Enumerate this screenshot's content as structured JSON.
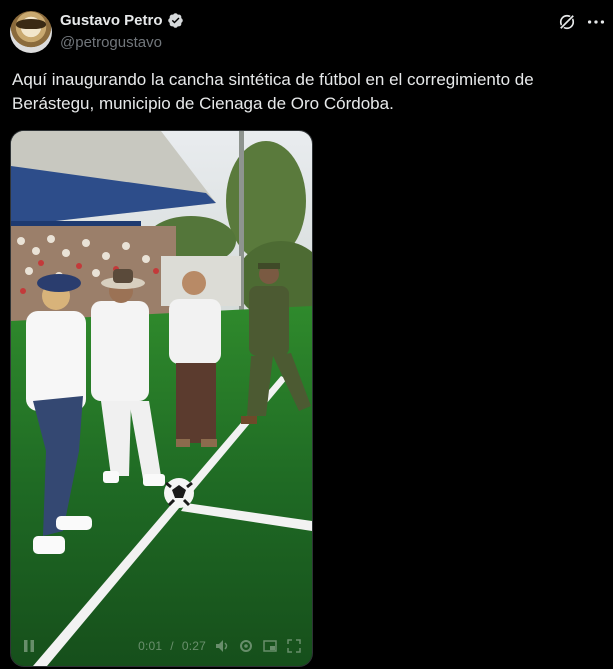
{
  "post": {
    "author_name": "Gustavo Petro",
    "author_handle": "@petrogustavo",
    "text": "Aquí inaugurando la cancha sintética de fútbol en el corregimiento de Berástegu, municipio de Cienaga de Oro Córdoba."
  },
  "video": {
    "time_current": "0:01",
    "time_separator": "/",
    "time_total": "0:27"
  },
  "icons": {
    "verified": "verified-badge-icon",
    "grok": "grok-icon",
    "more": "more-options-icon",
    "pause": "pause-icon",
    "volume": "volume-icon",
    "settings": "settings-icon",
    "pip": "picture-in-picture-icon",
    "fullscreen": "fullscreen-icon"
  },
  "colors": {
    "background": "#000000",
    "text": "#e7e9ea",
    "muted": "#71767b",
    "verified": "#e7e9ea"
  }
}
